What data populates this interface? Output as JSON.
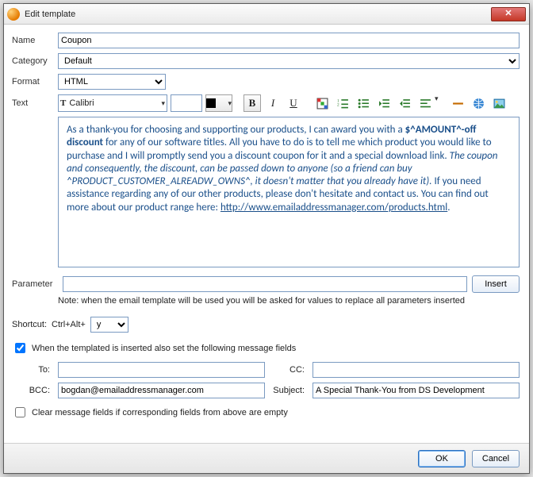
{
  "window": {
    "title": "Edit template"
  },
  "labels": {
    "name": "Name",
    "category": "Category",
    "format": "Format",
    "text": "Text",
    "parameter": "Parameter",
    "shortcut": "Shortcut:",
    "shortcut_prefix": "Ctrl+Alt+",
    "to": "To:",
    "cc": "CC:",
    "bcc": "BCC:",
    "subject": "Subject:"
  },
  "name_value": "Coupon",
  "category_value": "Default",
  "format_value": "HTML",
  "font": {
    "name": "Calibri",
    "size": ""
  },
  "body": {
    "seg1": "As a thank-you for choosing and supporting our products, I can award you with a ",
    "seg2_bold": "$^AMOUNT^-off discount",
    "seg3": " for any of our software titles. All you have to do is to tell me which product you would like to purchase and I will promptly send you a discount coupon for it and a special download link. ",
    "seg4_italic": "The coupon and consequently, the discount, can be passed down to anyone (so a friend can buy ^PRODUCT_CUSTOMER_ALREADW_OWNS^, it doesn't matter that you already have it).",
    "seg5": " If you need assistance regarding any of our other products, please don't hesitate and contact us. You can find out more about our product range here: ",
    "link": "http://www.emailaddressmanager.com/products.html",
    "seg6": "."
  },
  "parameter_value": "",
  "insert_label": "Insert",
  "note_text": "Note: when the email template will be used you will be asked for values to replace all parameters inserted",
  "shortcut_key": "y",
  "set_fields_checked": true,
  "set_fields_label": "When the templated is inserted also set the following message fields",
  "to_value": "",
  "cc_value": "",
  "bcc_value": "bogdan@emailaddressmanager.com",
  "subject_value": "A Special Thank-You from DS Development",
  "clear_fields_checked": false,
  "clear_fields_label": "Clear message fields if corresponding fields from above are empty",
  "buttons": {
    "ok": "OK",
    "cancel": "Cancel"
  }
}
